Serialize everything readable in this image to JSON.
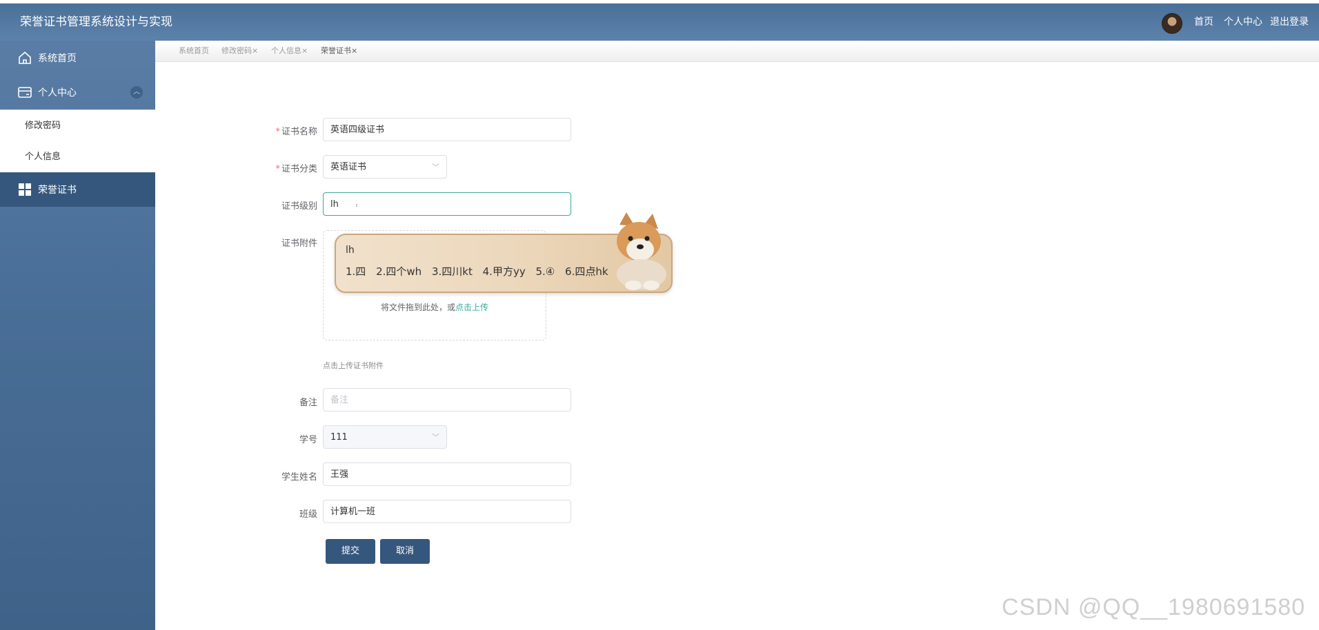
{
  "header": {
    "title": "荣誉证书管理系统设计与实现",
    "nav": [
      "首页",
      "个人中心",
      "退出登录"
    ]
  },
  "sidebar": {
    "items": [
      {
        "label": "系统首页",
        "icon": "home-icon"
      },
      {
        "label": "个人中心",
        "icon": "card-icon"
      },
      {
        "label": "荣誉证书",
        "icon": "grid-icon"
      }
    ],
    "sub_items": [
      "修改密码",
      "个人信息"
    ]
  },
  "tabs": [
    {
      "label": "系统首页",
      "closable": false
    },
    {
      "label": "修改密码",
      "closable": true
    },
    {
      "label": "个人信息",
      "closable": true
    },
    {
      "label": "荣誉证书",
      "closable": true
    }
  ],
  "form": {
    "cert_name": {
      "label": "证书名称",
      "value": "英语四级证书",
      "required": true
    },
    "cert_category": {
      "label": "证书分类",
      "value": "英语证书",
      "required": true
    },
    "cert_level": {
      "label": "证书级别",
      "value": "lh"
    },
    "cert_attachment": {
      "label": "证书附件",
      "upload_text": "将文件拖到此处，或",
      "upload_link": "点击上传",
      "hint": "点击上传证书附件"
    },
    "remark": {
      "label": "备注",
      "placeholder": "备注"
    },
    "student_id": {
      "label": "学号",
      "value": "111"
    },
    "student_name": {
      "label": "学生姓名",
      "value": "王强"
    },
    "class": {
      "label": "班级",
      "value": "计算机一班"
    },
    "submit": "提交",
    "cancel": "取消"
  },
  "ime": {
    "composition": "lh",
    "candidates": [
      "1.四",
      "2.四个wh",
      "3.四川kt",
      "4.甲方yy",
      "5.④",
      "6.四点hk"
    ]
  },
  "watermark": "CSDN @QQ__1980691580",
  "colors": {
    "header": "#4a6f98",
    "sidebar_active": "#36577d",
    "accent": "#3aa89a",
    "required": "#f56c6c"
  }
}
